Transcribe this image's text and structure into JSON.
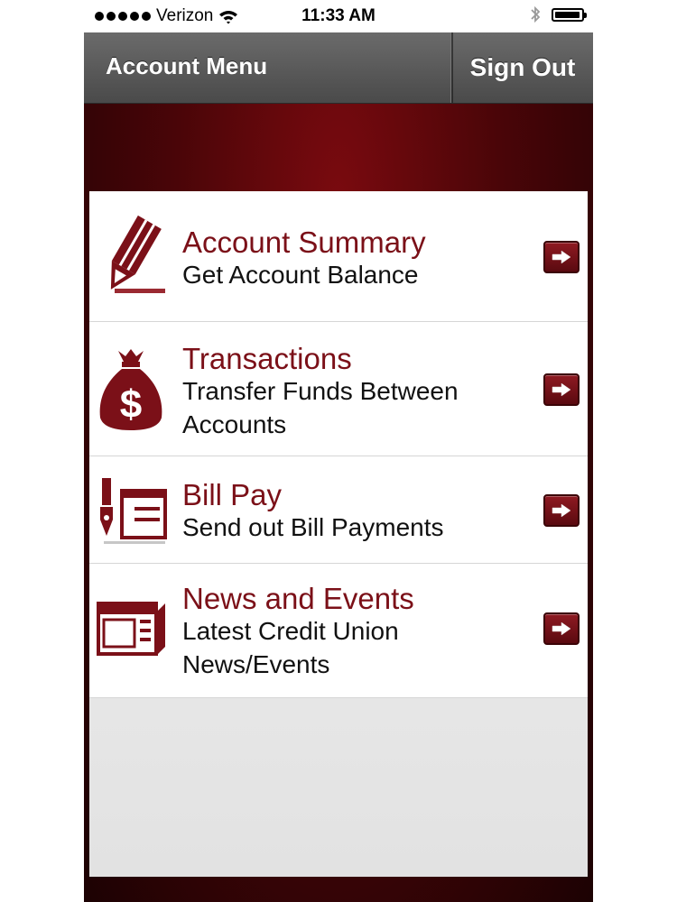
{
  "status_bar": {
    "carrier": "Verizon",
    "time": "11:33 AM"
  },
  "nav": {
    "title": "Account Menu",
    "sign_out": "Sign Out"
  },
  "menu": {
    "items": [
      {
        "title": "Account Summary",
        "subtitle": "Get Account Balance",
        "icon": "pencil-icon"
      },
      {
        "title": "Transactions",
        "subtitle": "Transfer Funds Between Accounts",
        "icon": "money-bag-icon"
      },
      {
        "title": "Bill Pay",
        "subtitle": "Send out Bill Payments",
        "icon": "pen-check-icon"
      },
      {
        "title": "News and Events",
        "subtitle": "Latest Credit Union News/Events",
        "icon": "newspaper-icon"
      }
    ]
  },
  "colors": {
    "accent": "#7b1018",
    "background_dark": "#4a0508",
    "nav_bar": "#595959"
  }
}
